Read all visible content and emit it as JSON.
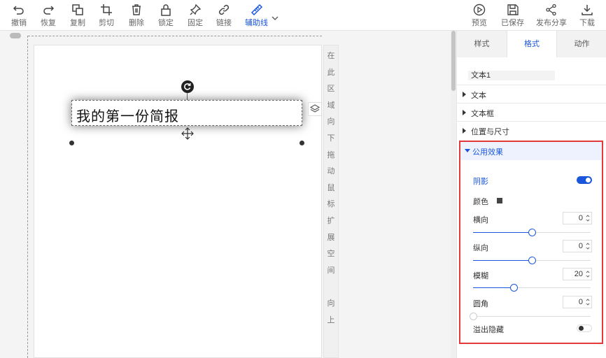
{
  "toolbar": {
    "left": [
      {
        "id": "undo",
        "label": "撤销",
        "icon": "undo-icon"
      },
      {
        "id": "redo",
        "label": "恢复",
        "icon": "redo-icon"
      },
      {
        "id": "copy",
        "label": "复制",
        "icon": "copy-icon"
      },
      {
        "id": "crop",
        "label": "剪切",
        "icon": "crop-icon"
      },
      {
        "id": "delete",
        "label": "删除",
        "icon": "trash-icon"
      },
      {
        "id": "lock",
        "label": "锁定",
        "icon": "lock-icon"
      },
      {
        "id": "pin",
        "label": "固定",
        "icon": "pin-icon"
      },
      {
        "id": "link",
        "label": "链接",
        "icon": "link-icon"
      },
      {
        "id": "guides",
        "label": "辅助线",
        "icon": "ruler-icon",
        "active": true
      }
    ],
    "right": [
      {
        "id": "preview",
        "label": "预览",
        "icon": "play-circle-icon"
      },
      {
        "id": "saved",
        "label": "已保存",
        "icon": "save-icon"
      },
      {
        "id": "share",
        "label": "发布分享",
        "icon": "share-icon"
      },
      {
        "id": "download",
        "label": "下载",
        "icon": "download-icon"
      }
    ],
    "accent": "#1a56db"
  },
  "canvas": {
    "textbox_text": "我的第一份简报",
    "hint_chars": [
      "在",
      "此",
      "区",
      "域",
      "向",
      "下",
      "拖",
      "动",
      "鼠",
      "标",
      "扩",
      "展",
      "空",
      "间",
      "",
      "向",
      "上"
    ]
  },
  "panel": {
    "tabs": [
      {
        "label": "样式",
        "active": false
      },
      {
        "label": "格式",
        "active": true
      },
      {
        "label": "动作",
        "active": false
      }
    ],
    "element_name": "文本1",
    "sections": [
      "文本",
      "文本框",
      "位置与尺寸"
    ],
    "effects": {
      "title": "公用效果",
      "shadow_label": "阴影",
      "shadow_on": true,
      "color_label": "颜色",
      "color": "#444444",
      "horizontal_label": "横向",
      "horizontal_value": "0",
      "horizontal_fraction": 0.5,
      "vertical_label": "纵向",
      "vertical_value": "0",
      "vertical_fraction": 0.5,
      "blur_label": "模糊",
      "blur_value": "20",
      "blur_fraction": 0.345,
      "radius_label": "圆角",
      "radius_value": "0",
      "radius_fraction": 0,
      "overflow_label": "溢出隐藏",
      "overflow_on": false,
      "highlight_color": "#e23a3a"
    }
  }
}
